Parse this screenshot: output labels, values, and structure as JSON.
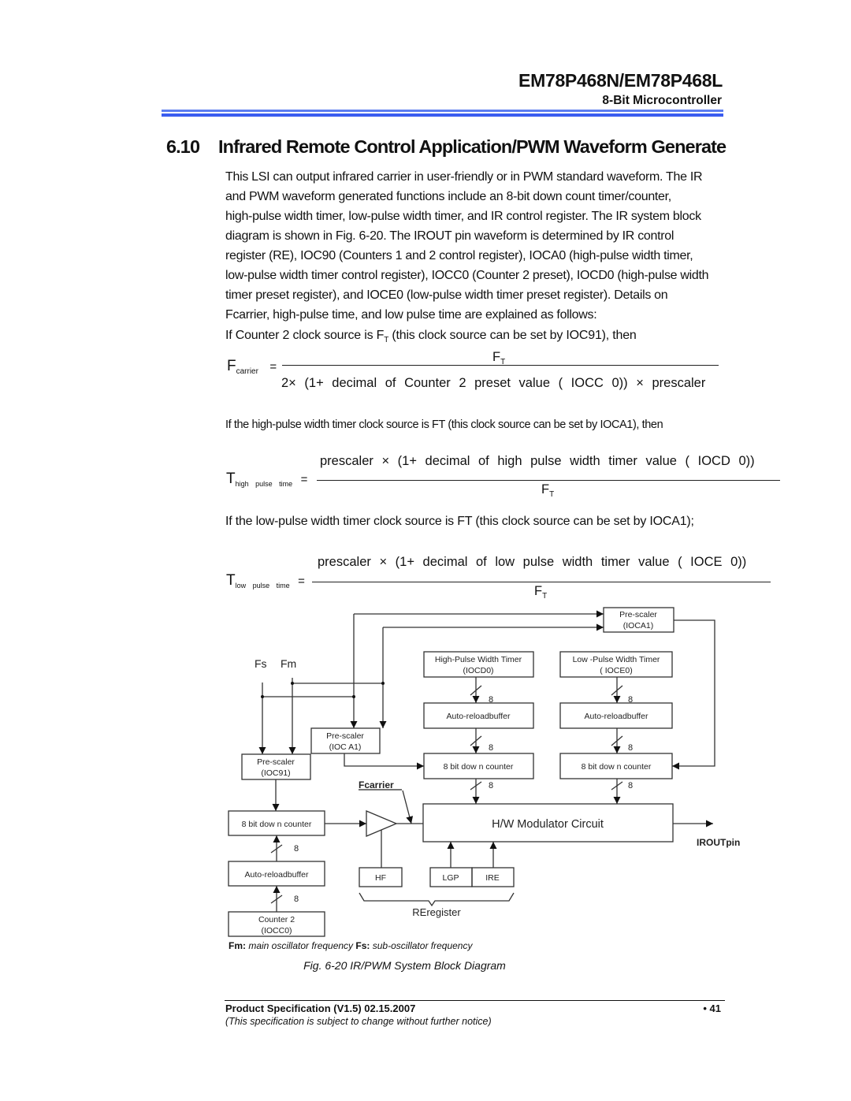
{
  "header": {
    "product": "EM78P468N/EM78P468L",
    "subtitle": "8-Bit Microcontroller",
    "rule_colors": [
      "#5b7cf0",
      "#3a5cf0"
    ]
  },
  "section": {
    "number": "6.10",
    "title": "Infrared Remote Control Application/PWM Waveform Generate"
  },
  "intro_lines": [
    "This LSI can output infrared carrier in user-friendly or in PWM standard waveform.  The IR",
    "and PWM waveform generated functions include an 8-bit down count timer/counter,",
    "high-pulse width timer, low-pulse width timer, and IR control register.  The IR system block",
    "diagram is shown in Fig. 6-20.  The IROUT pin waveform is determined by IR control",
    "register (RE), IOC90 (Counters 1 and 2 control register), IOCA0 (high-pulse width timer,",
    "low-pulse width timer control register), IOCC0 (Counter 2 preset), IOCD0 (high-pulse width",
    "timer preset register), and IOCE0 (low-pulse width timer preset register).  Details on",
    "Fcarrier, high-pulse time, and low pulse time are explained as follows:"
  ],
  "formulas": {
    "carrier": {
      "intro_pre": "If Counter 2 clock source is F",
      "intro_sub": "T",
      "intro_post": " (this clock source can be set by IOC91), then",
      "lhs": "F",
      "lhs_sub": "carrier",
      "eq": "=",
      "numerator": "F",
      "numerator_sub": "T",
      "denominator": "2× (1+ decimal   of   Counter   2   preset value   ( IOCC 0)) × prescaler"
    },
    "high_pulse": {
      "intro": "If the high-pulse width timer clock source is FT (this clock source can be set by IOCA1), then",
      "lhs": "T",
      "lhs_sub": "high   pulse   time",
      "eq": "=",
      "numerator": "prescaler  × (1+ decimal    of    high     pulse   width    timer  value    ( IOCD  0))",
      "denominator": "F",
      "denominator_sub": "T"
    },
    "low_pulse": {
      "intro": "If the low-pulse width timer clock source is FT (this clock source can be set by IOCA1);",
      "lhs": "T",
      "lhs_sub": "low   pulse   time",
      "eq": "=",
      "numerator": "prescaler × (1+ decimal    of    low     pulse   width    timer value    ( IOCE 0))",
      "denominator": "F",
      "denominator_sub": "T"
    }
  },
  "diagram": {
    "inputs": {
      "fs": "Fs",
      "fm": "Fm"
    },
    "prescaler_ioca1_top": {
      "line1": "Pre-scaler",
      "line2": "(IOCA1)"
    },
    "high_pulse_timer": {
      "line1": "High-Pulse  Width  Timer",
      "line2": "(IOCD0)"
    },
    "low_pulse_timer": {
      "line1": "Low -Pulse  Width  Timer",
      "line2": "(  IOCE0)"
    },
    "auto_reload_high": "Auto-reloadbuffer",
    "auto_reload_low": "Auto-reloadbuffer",
    "prescaler_ioca1_mid": {
      "line1": "Pre-scaler",
      "line2": "(IOC A1)"
    },
    "counter_high": "8 bit dow n counter",
    "counter_low": "8 bit dow n counter",
    "prescaler_ioc91": {
      "line1": "Pre-scaler",
      "line2": "(IOC91)"
    },
    "fcarrier_label": "Fcarrier",
    "counter2_down": "8 bit  dow n counter",
    "auto_reload_c2": "Auto-reloadbuffer",
    "counter2": {
      "line1": "Counter 2",
      "line2": "(IOCC0)"
    },
    "modulator": "H/W  Modulator  Circuit",
    "output_label": "IROUTpin",
    "hf": "HF",
    "lgp": "LGP",
    "ire": "IRE",
    "register_label": "REregister",
    "bus_width": "8"
  },
  "note": {
    "fm_key": "Fm:",
    "fm_text": " main oscillator frequency ",
    "fs_key": "Fs:",
    "fs_text": " sub-oscillator frequency"
  },
  "figure_caption": "Fig. 6-20  IR/PWM System Block Diagram",
  "footer": {
    "spec": "Product Specification (V1.5) 02.15.2007",
    "page": "• 41",
    "notice": "(This specification is subject to change without further notice)"
  }
}
